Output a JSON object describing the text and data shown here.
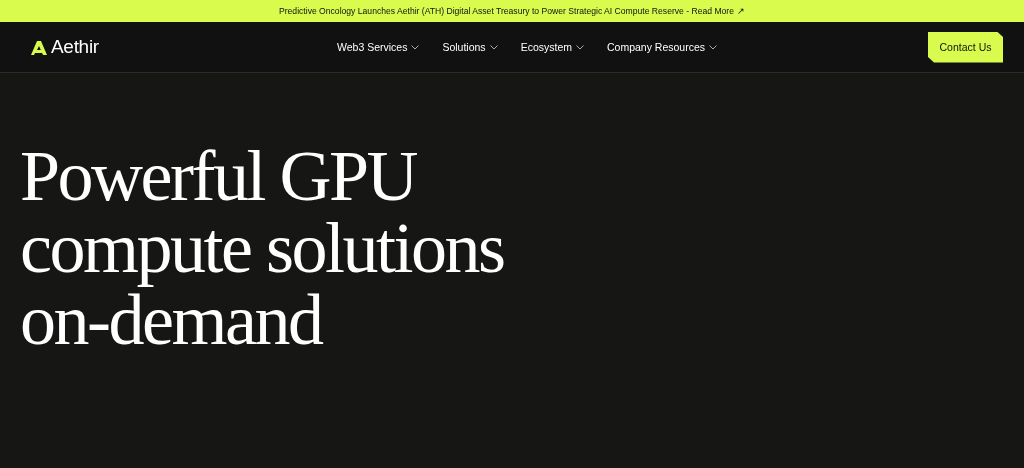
{
  "announcement": {
    "text": "Predictive Oncology Launches Aethir (ATH) Digital Asset Treasury to Power Strategic AI Compute Reserve - Read More",
    "arrow": "↗"
  },
  "brand": {
    "name": "Aethir"
  },
  "nav": [
    {
      "label": "Web3 Services"
    },
    {
      "label": "Solutions"
    },
    {
      "label": "Ecosystem"
    },
    {
      "label": "Company Resources"
    }
  ],
  "contact_button": {
    "label": "Contact Us"
  },
  "hero": {
    "headline_lines": [
      "Powerful GPU",
      "compute solutions",
      "on-demand"
    ]
  }
}
